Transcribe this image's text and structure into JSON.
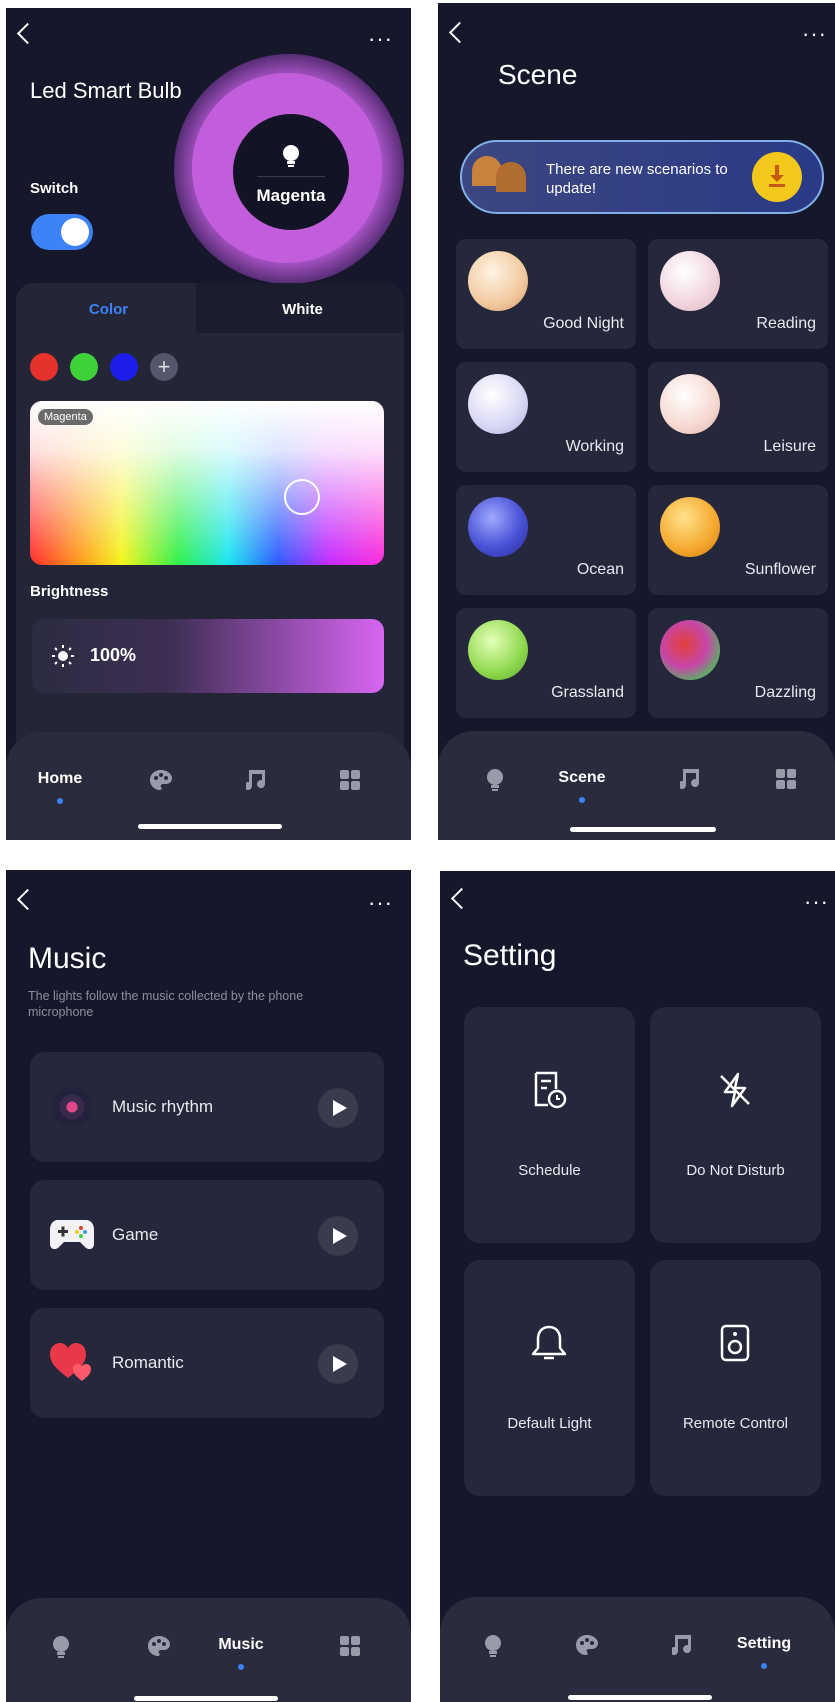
{
  "home": {
    "title": "Led Smart Bulb",
    "color_name": "Magenta",
    "switch_label": "Switch",
    "switch_on": true,
    "tabs": [
      "Color",
      "White"
    ],
    "active_tab": "Color",
    "swatches": [
      "#e5322c",
      "#3fd13a",
      "#1b1de8"
    ],
    "add_icon": "plus-icon",
    "picker_label": "Magenta",
    "brightness_label": "Brightness",
    "brightness_value": "100%",
    "nav": [
      "Home",
      "",
      "",
      ""
    ]
  },
  "scene": {
    "title": "Scene",
    "banner_text": "There are new scenarios to update!",
    "download_icon": "download-icon",
    "items": [
      {
        "label": "Good Night",
        "color": "#f2c9a0"
      },
      {
        "label": "Reading",
        "color": "#f0d4dc"
      },
      {
        "label": "Working",
        "color": "#d8d6f4"
      },
      {
        "label": "Leisure",
        "color": "#f6d8d0"
      },
      {
        "label": "Ocean",
        "color": "#4a52d6"
      },
      {
        "label": "Sunflower",
        "color": "#f4a82e"
      },
      {
        "label": "Grassland",
        "color": "#8fd84e"
      },
      {
        "label": "Dazzling",
        "color": "#c845a8"
      }
    ],
    "nav": [
      "",
      "Scene",
      "",
      ""
    ]
  },
  "music": {
    "title": "Music",
    "subtitle": "The lights follow the music collected by the phone microphone",
    "items": [
      {
        "label": "Music rhythm",
        "icon": "vinyl-record-icon"
      },
      {
        "label": "Game",
        "icon": "gamepad-icon"
      },
      {
        "label": "Romantic",
        "icon": "hearts-icon"
      }
    ],
    "nav": [
      "",
      "",
      "Music",
      ""
    ]
  },
  "setting": {
    "title": "Setting",
    "items": [
      {
        "label": "Schedule",
        "icon": "schedule-icon"
      },
      {
        "label": "Do Not Disturb",
        "icon": "do-not-disturb-icon"
      },
      {
        "label": "Default Light",
        "icon": "bell-icon"
      },
      {
        "label": "Remote Control",
        "icon": "speaker-icon"
      }
    ],
    "nav": [
      "",
      "",
      "",
      "Setting"
    ]
  },
  "colors": {
    "background": "#16172b",
    "accent": "#3d82f6",
    "magenta": "#d866f2"
  }
}
